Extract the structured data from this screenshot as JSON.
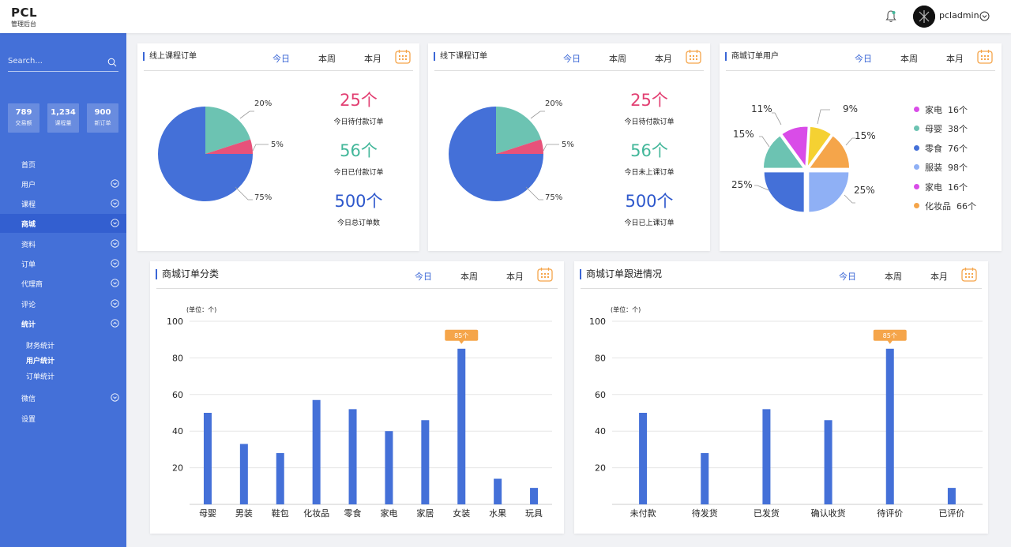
{
  "app": {
    "logo": "PCL",
    "subtitle": "管理后台"
  },
  "header": {
    "username": "pcladmin"
  },
  "sidebar": {
    "search_placeholder": "Search...",
    "stats": [
      {
        "value": "789",
        "label": "交易额"
      },
      {
        "value": "1,234",
        "label": "课程量"
      },
      {
        "value": "900",
        "label": "新订单"
      }
    ],
    "menu": [
      {
        "label": "首页"
      },
      {
        "label": "用户"
      },
      {
        "label": "课程"
      },
      {
        "label": "商城"
      },
      {
        "label": "资料"
      },
      {
        "label": "订单"
      },
      {
        "label": "代理商"
      },
      {
        "label": "评论"
      },
      {
        "label": "统计"
      },
      {
        "label": "微信"
      },
      {
        "label": "设置"
      }
    ],
    "submenu": [
      {
        "label": "财务统计"
      },
      {
        "label": "用户统计"
      },
      {
        "label": "订单统计"
      }
    ]
  },
  "tabs": {
    "today": "今日",
    "week": "本周",
    "month": "本月"
  },
  "panels": {
    "online": {
      "title": "线上课程订单",
      "pcts": [
        "20%",
        "5%",
        "75%"
      ],
      "stats": [
        {
          "value": "25个",
          "label": "今日待付款订单",
          "color": "#e23f72"
        },
        {
          "value": "56个",
          "label": "今日已付款订单",
          "color": "#43b79a"
        },
        {
          "value": "500个",
          "label": "今日总订单数",
          "color": "#2e58cc"
        }
      ]
    },
    "offline": {
      "title": "线下课程订单",
      "pcts": [
        "20%",
        "5%",
        "75%"
      ],
      "stats": [
        {
          "value": "25个",
          "label": "今日待付款订单",
          "color": "#e23f72"
        },
        {
          "value": "56个",
          "label": "今日未上课订单",
          "color": "#43b79a"
        },
        {
          "value": "500个",
          "label": "今日已上课订单",
          "color": "#2e58cc"
        }
      ]
    },
    "users": {
      "title": "商城订单用户",
      "pcts": [
        "11%",
        "9%",
        "15%",
        "15%",
        "25%",
        "25%"
      ],
      "legend": [
        {
          "name": "家电",
          "value": "16个",
          "color": "#d94ce8"
        },
        {
          "name": "母婴",
          "value": "38个",
          "color": "#6cc3b2"
        },
        {
          "name": "零食",
          "value": "76个",
          "color": "#4470d8"
        },
        {
          "name": "服装",
          "value": "98个",
          "color": "#8fb0f5"
        },
        {
          "name": "家电",
          "value": "16个",
          "color": "#d94ce8"
        },
        {
          "name": "化妆品",
          "value": "66个",
          "color": "#f5a54a"
        }
      ]
    },
    "category": {
      "title": "商城订单分类",
      "unit": "(单位：个)",
      "tooltip": "85个"
    },
    "progress": {
      "title": "商城订单跟进情况",
      "unit": "(单位：个)",
      "tooltip": "85个"
    }
  },
  "chart_data": [
    {
      "type": "pie",
      "title": "线上课程订单",
      "values": [
        75,
        20,
        5
      ],
      "colors": [
        "#4470d8",
        "#6cc3b2",
        "#e7527a"
      ]
    },
    {
      "type": "pie",
      "title": "线下课程订单",
      "values": [
        75,
        20,
        5
      ],
      "colors": [
        "#4470d8",
        "#6cc3b2",
        "#e7527a"
      ]
    },
    {
      "type": "pie",
      "title": "商城订单用户",
      "values": [
        25,
        25,
        15,
        11,
        9,
        15
      ],
      "colors": [
        "#8fb0f5",
        "#4470d8",
        "#6cc3b2",
        "#d94ce8",
        "#f5d132",
        "#f5a54a"
      ]
    },
    {
      "type": "bar",
      "title": "商城订单分类",
      "ylabel": "(单位：个)",
      "ylim": [
        0,
        100
      ],
      "yticks": [
        20,
        40,
        60,
        80,
        100
      ],
      "categories": [
        "母婴",
        "男装",
        "鞋包",
        "化妆品",
        "零食",
        "家电",
        "家居",
        "女装",
        "水果",
        "玩具"
      ],
      "values": [
        50,
        33,
        28,
        57,
        52,
        40,
        46,
        85,
        14,
        9
      ],
      "color": "#4470d8"
    },
    {
      "type": "bar",
      "title": "商城订单跟进情况",
      "ylabel": "(单位：个)",
      "ylim": [
        0,
        100
      ],
      "yticks": [
        20,
        40,
        60,
        80,
        100
      ],
      "categories": [
        "未付款",
        "待发货",
        "已发货",
        "确认收货",
        "待评价",
        "已评价"
      ],
      "values": [
        50,
        28,
        52,
        46,
        85,
        9
      ],
      "color": "#4470d8"
    }
  ]
}
